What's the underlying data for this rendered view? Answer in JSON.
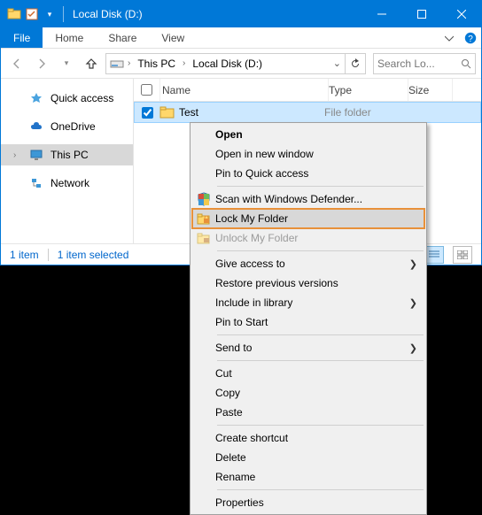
{
  "titlebar": {
    "title": "Local Disk (D:)"
  },
  "ribbon": {
    "file": "File",
    "tabs": [
      "Home",
      "Share",
      "View"
    ]
  },
  "breadcrumb": {
    "items": [
      "This PC",
      "Local Disk (D:)"
    ]
  },
  "search": {
    "placeholder": "Search Lo..."
  },
  "nav": {
    "items": [
      {
        "label": "Quick access"
      },
      {
        "label": "OneDrive"
      },
      {
        "label": "This PC"
      },
      {
        "label": "Network"
      }
    ]
  },
  "columns": {
    "name": "Name",
    "type": "Type",
    "size": "Size"
  },
  "rows": [
    {
      "name": "Test",
      "type": "File folder",
      "checked": true
    }
  ],
  "status": {
    "count": "1 item",
    "selected": "1 item selected"
  },
  "context_menu": {
    "items": [
      {
        "label": "Open",
        "bold": true
      },
      {
        "label": "Open in new window"
      },
      {
        "label": "Pin to Quick access"
      },
      {
        "sep": true
      },
      {
        "label": "Scan with Windows Defender...",
        "icon": "shield"
      },
      {
        "label": "Lock My Folder",
        "icon": "lockfolder",
        "hover": true,
        "highlight": true
      },
      {
        "label": "Unlock My Folder",
        "icon": "unlockfolder",
        "disabled": true
      },
      {
        "sep": true
      },
      {
        "label": "Give access to",
        "arrow": true
      },
      {
        "label": "Restore previous versions"
      },
      {
        "label": "Include in library",
        "arrow": true
      },
      {
        "label": "Pin to Start"
      },
      {
        "sep": true
      },
      {
        "label": "Send to",
        "arrow": true
      },
      {
        "sep": true
      },
      {
        "label": "Cut"
      },
      {
        "label": "Copy"
      },
      {
        "label": "Paste"
      },
      {
        "sep": true
      },
      {
        "label": "Create shortcut"
      },
      {
        "label": "Delete"
      },
      {
        "label": "Rename"
      },
      {
        "sep": true
      },
      {
        "label": "Properties"
      }
    ]
  }
}
